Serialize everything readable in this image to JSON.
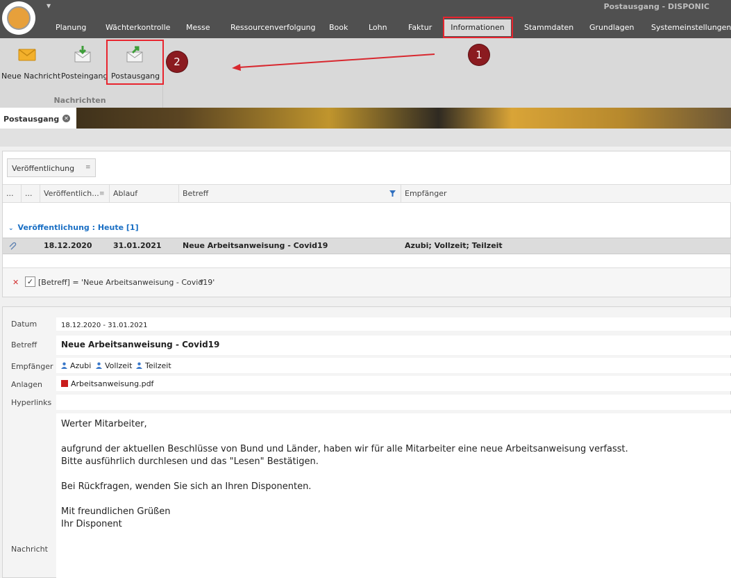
{
  "window": {
    "title": "Postausgang - DISPONIC"
  },
  "menu": {
    "items": [
      "Planung",
      "Wächterkontrolle",
      "Messe",
      "Ressourcenverfolgung",
      "Book",
      "Lohn",
      "Faktur",
      "Informationen",
      "Stammdaten",
      "Grundlagen",
      "Systemeinstellungen"
    ],
    "active": "Informationen"
  },
  "ribbon": {
    "buttons": [
      {
        "label": "Neue Nachricht",
        "icon": "envelope-icon"
      },
      {
        "label": "Posteingang",
        "icon": "inbox-download-icon"
      },
      {
        "label": "Postausgang",
        "icon": "outbox-upload-icon"
      }
    ],
    "group_label": "Nachrichten"
  },
  "annotations": {
    "marker_1": "1",
    "marker_2": "2",
    "highlight_color": "#e8242e",
    "marker_color": "#8b1b20"
  },
  "doc_tab": {
    "label": "Postausgang"
  },
  "grid": {
    "group_chip": "Veröffentlichung",
    "columns": [
      "...",
      "...",
      "Veröffentlich...",
      "Ablauf",
      "Betreff",
      "Empfänger"
    ],
    "group_row": "Veröffentlichung : Heute [1]",
    "rows": [
      {
        "published": "18.12.2020",
        "expires": "31.01.2021",
        "subject": "Neue Arbeitsanweisung - Covid19",
        "recipients": "Azubi; Vollzeit; Teilzeit"
      }
    ],
    "filter_text": "[Betreff] = 'Neue Arbeitsanweisung - Covid19'"
  },
  "detail": {
    "labels": {
      "date": "Datum",
      "subject": "Betreff",
      "recipients": "Empfänger",
      "attachments": "Anlagen",
      "hyperlinks": "Hyperlinks",
      "message": "Nachricht"
    },
    "date_value": "18.12.2020 - 31.01.2021",
    "subject_value": "Neue Arbeitsanweisung - Covid19",
    "recipients": [
      "Azubi",
      "Vollzeit",
      "Teilzeit"
    ],
    "attachment": "Arbeitsanweisung.pdf",
    "message_lines": [
      "Werter Mitarbeiter,",
      "",
      "aufgrund der aktuellen Beschlüsse von Bund und Länder, haben wir für alle Mitarbeiter eine neue Arbeitsanweisung verfasst.",
      "Bitte ausführlich durchlesen und das \"Lesen\" Bestätigen.",
      "",
      "Bei Rückfragen, wenden Sie sich an Ihren Disponenten.",
      "",
      "Mit freundlichen Grüßen",
      "Ihr Disponent"
    ]
  }
}
